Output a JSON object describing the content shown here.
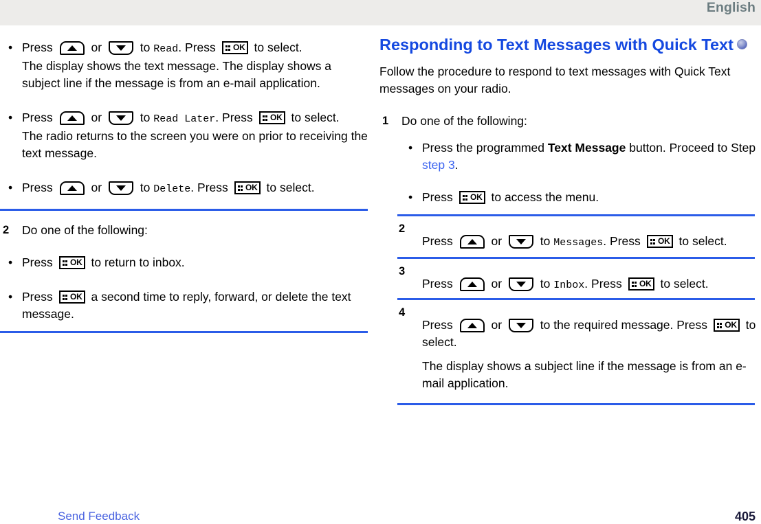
{
  "header": {
    "language_label": "English"
  },
  "icons": {
    "up_key": "up-arrow-key-icon",
    "down_key": "down-arrow-key-icon",
    "ok_key": "menu-ok-key-icon",
    "ok_key_label": "OK",
    "heading_badge": "display-model-badge-icon"
  },
  "colors": {
    "rule_blue": "#2b5ce8",
    "heading_blue": "#1549e0",
    "link_blue": "#3c64f0",
    "header_band": "#edecea",
    "language_gray": "#6b7c80"
  },
  "left_column": {
    "bullets": [
      {
        "prefix": "Press",
        "mid": "or",
        "to": "to",
        "target": "Read",
        "sep": ". Press",
        "suffix": "to select.",
        "note": "The display shows the text message. The display shows a subject line if the message is from an e-mail application."
      },
      {
        "prefix": "Press",
        "mid": "or",
        "to": "to",
        "target": "Read Later",
        "sep": ". Press",
        "suffix": "to select.",
        "note": "The radio returns to the screen you were on prior to receiving the text message."
      },
      {
        "prefix": "Press",
        "mid": "or",
        "to": "to",
        "target": "Delete",
        "sep": ". Press",
        "suffix": "to select.",
        "note": ""
      }
    ],
    "step2": {
      "number": "2",
      "text": "Do one of the following:",
      "bullets": [
        {
          "prefix": "Press",
          "suffix": "to return to inbox."
        },
        {
          "prefix": "Press",
          "suffix": "a second time to reply, forward, or delete the text message."
        }
      ]
    }
  },
  "right_column": {
    "heading": "Responding to Text Messages with Quick Text",
    "intro": "Follow the procedure to respond to text messages with Quick Text messages on your radio.",
    "steps": [
      {
        "number": "1",
        "text": "Do one of the following:",
        "bullets": [
          {
            "pre": "Press the programmed",
            "bold": "Text Message",
            "post": "button. Proceed to Step",
            "link": "step 3",
            "end": "."
          },
          {
            "pre": "Press",
            "post": "to access the menu."
          }
        ]
      },
      {
        "number": "2",
        "prefix": "Press",
        "mid": "or",
        "to": "to",
        "target": "Messages",
        "sep": ". Press",
        "suffix": "to select."
      },
      {
        "number": "3",
        "prefix": "Press",
        "mid": "or",
        "to": "to",
        "target": "Inbox",
        "sep": ". Press",
        "suffix": "to select."
      },
      {
        "number": "4",
        "prefix": "Press",
        "mid": "or",
        "to": "to the required message. Press",
        "suffix": "to select.",
        "note": "The display shows a subject line if the message is from an e-mail application."
      }
    ]
  },
  "footer": {
    "send_feedback": "Send Feedback",
    "page_number": "405"
  }
}
